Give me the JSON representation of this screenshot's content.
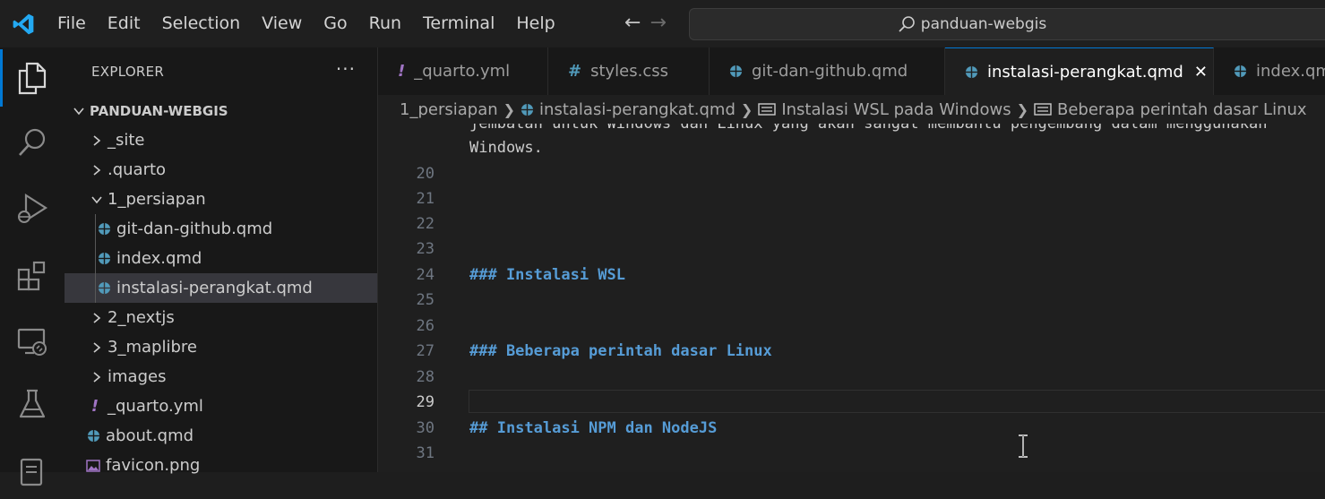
{
  "menu": [
    "File",
    "Edit",
    "Selection",
    "View",
    "Go",
    "Run",
    "Terminal",
    "Help"
  ],
  "command_center": {
    "text": "panduan-webgis"
  },
  "explorer": {
    "title": "EXPLORER",
    "more": "···",
    "folder": "PANDUAN-WEBGIS",
    "items": [
      {
        "label": "_site",
        "type": "folder-collapsed"
      },
      {
        "label": ".quarto",
        "type": "folder-collapsed"
      },
      {
        "label": "1_persiapan",
        "type": "folder-expanded"
      },
      {
        "label": "git-dan-github.qmd",
        "type": "qmd"
      },
      {
        "label": "index.qmd",
        "type": "qmd"
      },
      {
        "label": "instalasi-perangkat.qmd",
        "type": "qmd",
        "selected": true
      },
      {
        "label": "2_nextjs",
        "type": "folder-collapsed"
      },
      {
        "label": "3_maplibre",
        "type": "folder-collapsed"
      },
      {
        "label": "images",
        "type": "folder-collapsed"
      },
      {
        "label": "_quarto.yml",
        "type": "yml"
      },
      {
        "label": "about.qmd",
        "type": "qmd"
      },
      {
        "label": "favicon.png",
        "type": "png"
      }
    ]
  },
  "tabs": [
    {
      "label": "_quarto.yml",
      "icon": "yml-icon",
      "glyph": "!"
    },
    {
      "label": "styles.css",
      "icon": "css-icon",
      "glyph": "#"
    },
    {
      "label": "git-dan-github.qmd",
      "icon": "qmd-icon"
    },
    {
      "label": "instalasi-perangkat.qmd",
      "icon": "qmd-icon",
      "active": true
    },
    {
      "label": "index.qmd",
      "icon": "qmd-icon"
    }
  ],
  "tab_close": "✕",
  "breadcrumb": {
    "folder": "1_persiapan",
    "file": "instalasi-perangkat.qmd",
    "section1": "Instalasi WSL pada Windows",
    "section2": "Beberapa perintah dasar Linux"
  },
  "editor": {
    "lines": [
      {
        "num": "",
        "text": "jembatan untuk Windows dan Linux yang akan sangat membantu pengembang dalam menggunakan",
        "kind": "text",
        "clipped": true
      },
      {
        "num": "",
        "text": "Windows.",
        "kind": "text"
      },
      {
        "num": "20",
        "text": "",
        "kind": "text"
      },
      {
        "num": "21",
        "text": "",
        "kind": "text"
      },
      {
        "num": "22",
        "text": "",
        "kind": "text"
      },
      {
        "num": "23",
        "text": "",
        "kind": "text"
      },
      {
        "num": "24",
        "text": "### Instalasi WSL",
        "kind": "heading"
      },
      {
        "num": "25",
        "text": "",
        "kind": "text"
      },
      {
        "num": "26",
        "text": "",
        "kind": "text"
      },
      {
        "num": "27",
        "text": "### Beberapa perintah dasar Linux",
        "kind": "heading"
      },
      {
        "num": "28",
        "text": "",
        "kind": "text"
      },
      {
        "num": "29",
        "text": "",
        "kind": "text",
        "current": true
      },
      {
        "num": "30",
        "text": "## Instalasi NPM dan NodeJS",
        "kind": "heading"
      },
      {
        "num": "31",
        "text": "",
        "kind": "text"
      }
    ]
  },
  "colors": {
    "accent": "#0078d4",
    "heading": "#569cd6",
    "qmd_icon": "#519aba",
    "yml_icon": "#a074c4",
    "css_icon": "#519aba"
  }
}
